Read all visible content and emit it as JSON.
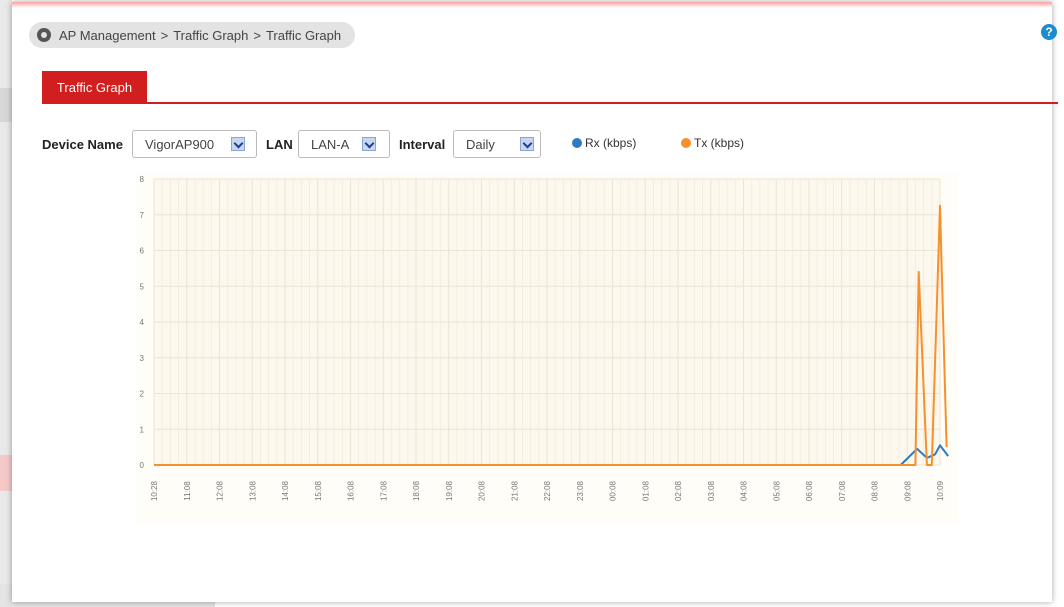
{
  "breadcrumb": {
    "items": [
      "AP Management",
      "Traffic Graph",
      "Traffic Graph"
    ],
    "separator": ">"
  },
  "help": {
    "label": "?"
  },
  "tab": {
    "label": "Traffic Graph"
  },
  "filters": {
    "device_name": {
      "label": "Device Name",
      "value": "VigorAP900"
    },
    "lan": {
      "label": "LAN",
      "value": "LAN-A"
    },
    "interval": {
      "label": "Interval",
      "value": "Daily"
    }
  },
  "legend": [
    {
      "name": "Rx (kbps)",
      "color": "#2f7bc0"
    },
    {
      "name": "Tx (kbps)",
      "color": "#f7902a"
    }
  ],
  "chart_data": {
    "type": "line",
    "categories": [
      "10:28",
      "11:08",
      "12:08",
      "13:08",
      "14:08",
      "15:08",
      "16:08",
      "17:08",
      "18:08",
      "19:08",
      "20:08",
      "21:08",
      "22:08",
      "23:08",
      "00:08",
      "01:08",
      "02:08",
      "03:08",
      "04:08",
      "05:08",
      "06:08",
      "07:08",
      "08:08",
      "09:08",
      "10:09"
    ],
    "yticks": [
      0,
      1,
      2,
      3,
      4,
      5,
      6,
      7,
      8
    ],
    "ylim": [
      0,
      8
    ],
    "grid": true,
    "series": [
      {
        "name": "Rx (kbps)",
        "color": "#2f7bc0",
        "points": [
          [
            0,
            0
          ],
          [
            22.8,
            0
          ],
          [
            23.3,
            0.45
          ],
          [
            23.6,
            0.2
          ],
          [
            23.85,
            0.3
          ],
          [
            24.0,
            0.55
          ],
          [
            24.25,
            0.25
          ]
        ]
      },
      {
        "name": "Tx (kbps)",
        "color": "#f7902a",
        "points": [
          [
            0,
            0
          ],
          [
            22.8,
            0
          ],
          [
            23.25,
            0
          ],
          [
            23.35,
            5.4
          ],
          [
            23.6,
            0
          ],
          [
            23.75,
            0
          ],
          [
            24.0,
            7.25
          ],
          [
            24.2,
            0.5
          ]
        ]
      }
    ]
  }
}
